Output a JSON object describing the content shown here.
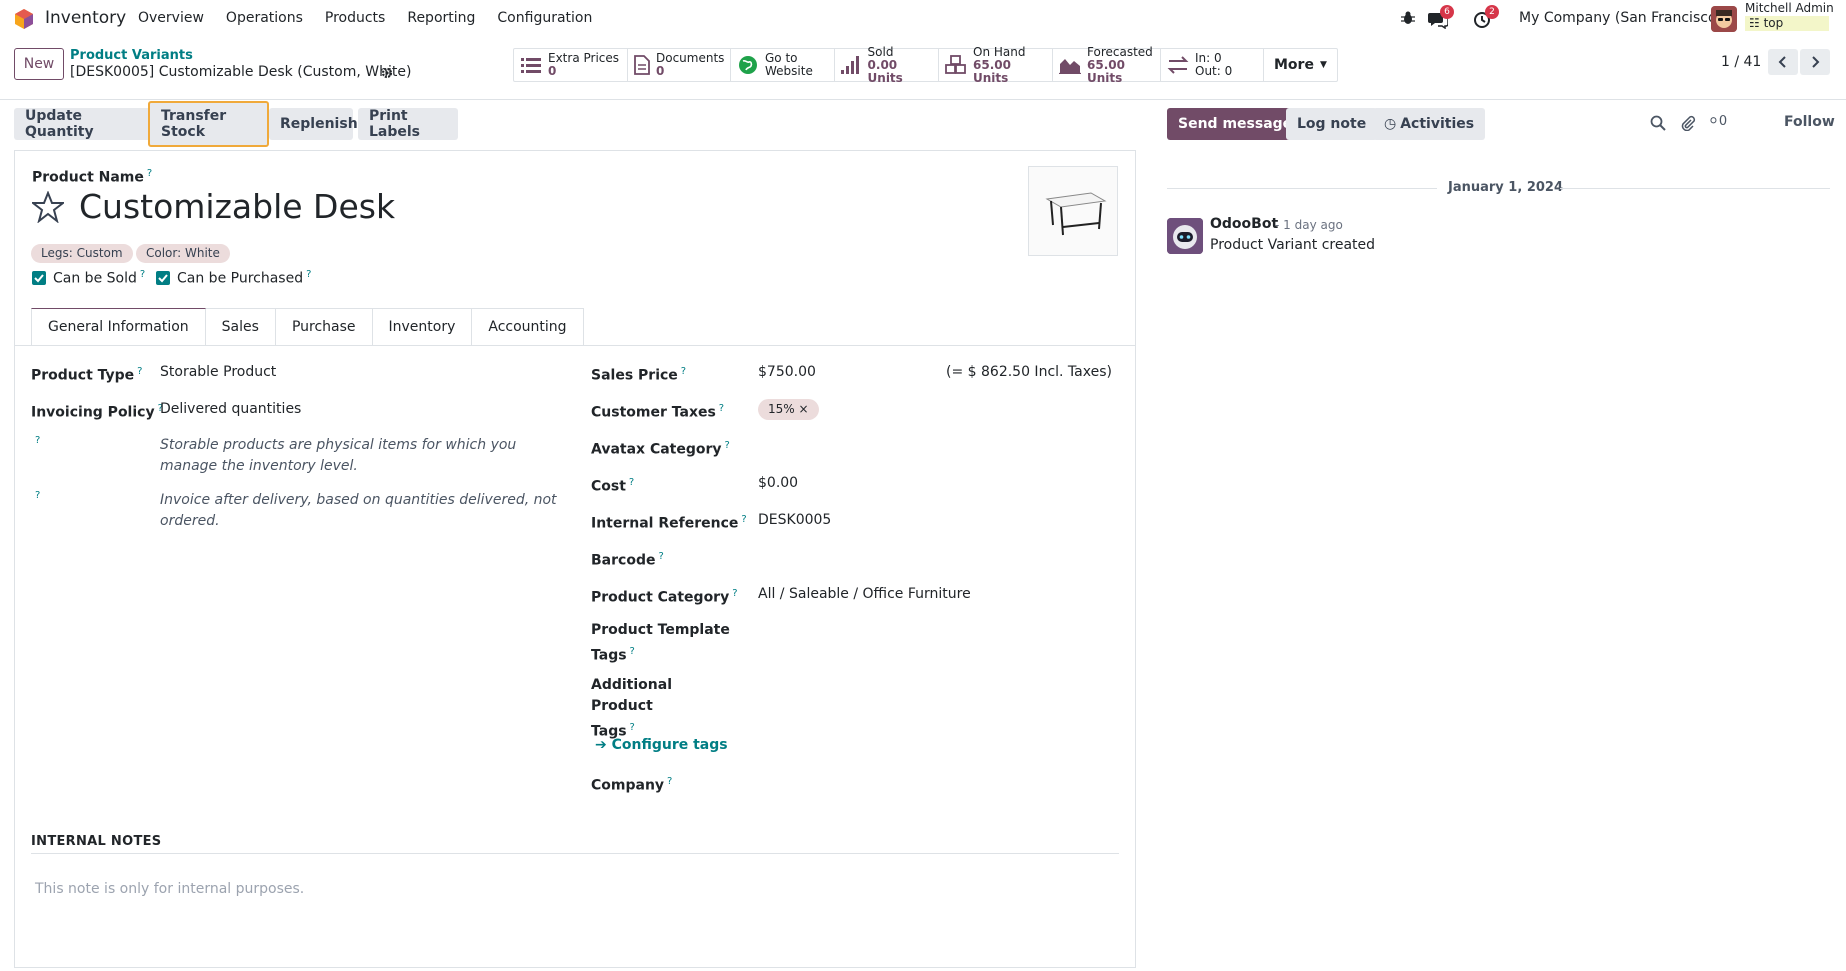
{
  "nav": {
    "app_name": "Inventory",
    "menu": [
      "Overview",
      "Operations",
      "Products",
      "Reporting",
      "Configuration"
    ],
    "chat_count": "6",
    "activity_count": "2",
    "company": "My Company (San Francisco)",
    "user_name": "Mitchell Admin",
    "user_db": "top"
  },
  "control": {
    "new_label": "New",
    "breadcrumb_parent": "Product Variants",
    "breadcrumb_current": "[DESK0005] Customizable Desk (Custom, White)",
    "smart_buttons": [
      {
        "label": "Extra Prices",
        "value": "0",
        "icon": "list-icon"
      },
      {
        "label": "Documents",
        "value": "0",
        "icon": "document-icon"
      },
      {
        "label": "Go to",
        "value": "Website",
        "icon": "globe-icon"
      },
      {
        "label": "Sold",
        "value": "0.00 Units",
        "icon": "signal-icon"
      },
      {
        "label": "On Hand",
        "value": "65.00 Units",
        "icon": "cubes-icon"
      },
      {
        "label": "Forecasted",
        "value": "65.00 Units",
        "icon": "area-chart-icon"
      },
      {
        "label": "In: 0",
        "value": "Out: 0",
        "icon": "exchange-icon"
      }
    ],
    "more_label": "More",
    "pager": "1 / 41"
  },
  "actions": {
    "update_quantity": "Update Quantity",
    "transfer_stock": "Transfer Stock",
    "replenish": "Replenish",
    "print_labels": "Print Labels"
  },
  "chatter_bar": {
    "send_message": "Send message",
    "log_note": "Log note",
    "activities": "Activities",
    "follower_count": "0",
    "follow": "Follow"
  },
  "form": {
    "product_name_label": "Product Name",
    "product_name": "Customizable Desk",
    "tags": [
      "Legs: Custom",
      "Color: White"
    ],
    "can_be_sold": "Can be Sold",
    "can_be_purchased": "Can be Purchased",
    "tabs": [
      "General Information",
      "Sales",
      "Purchase",
      "Inventory",
      "Accounting"
    ],
    "left": {
      "product_type_label": "Product Type",
      "product_type": "Storable Product",
      "invoicing_policy_label": "Invoicing Policy",
      "invoicing_policy": "Delivered quantities",
      "help_type": "Storable products are physical items for which you manage the inventory level.",
      "help_invoice": "Invoice after delivery, based on quantities delivered, not ordered."
    },
    "right": {
      "sales_price_label": "Sales Price",
      "sales_price": "$750.00",
      "sales_price_incl": "(= $ 862.50 Incl. Taxes)",
      "customer_taxes_label": "Customer Taxes",
      "customer_tax": "15%",
      "avatax_label": "Avatax Category",
      "cost_label": "Cost",
      "cost": "$0.00",
      "internal_ref_label": "Internal Reference",
      "internal_ref": "DESK0005",
      "barcode_label": "Barcode",
      "product_category_label": "Product Category",
      "product_category": "All / Saleable / Office Furniture",
      "template_tags_label_1": "Product Template",
      "template_tags_label_2": "Tags",
      "additional_tags_label_1": "Additional Product",
      "additional_tags_label_2": "Tags",
      "configure_tags": "Configure tags",
      "company_label": "Company"
    },
    "notes_title": "INTERNAL NOTES",
    "notes_placeholder": "This note is only for internal purposes."
  },
  "chatter": {
    "date": "January 1, 2024",
    "author": "OdooBot",
    "time": "- 1 day ago",
    "message": "Product Variant created"
  }
}
